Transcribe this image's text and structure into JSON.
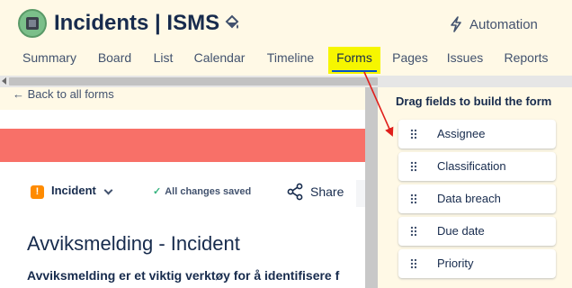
{
  "project": {
    "title": "Incidents | ISMS"
  },
  "header": {
    "automation_label": "Automation"
  },
  "tabs": [
    {
      "label": "Summary",
      "active": false
    },
    {
      "label": "Board",
      "active": false
    },
    {
      "label": "List",
      "active": false
    },
    {
      "label": "Calendar",
      "active": false
    },
    {
      "label": "Timeline",
      "active": false
    },
    {
      "label": "Forms",
      "active": true
    },
    {
      "label": "Pages",
      "active": false
    },
    {
      "label": "Issues",
      "active": false
    },
    {
      "label": "Reports",
      "active": false
    }
  ],
  "back_link": "← Back to all forms",
  "form": {
    "banner_color": "#f87068",
    "issue_type": "Incident",
    "save_status": "All changes saved",
    "share_label": "Share",
    "title": "Avviksmelding - Incident",
    "description": "Avviksmelding er et viktig verktøy for å identifisere f"
  },
  "panel": {
    "title": "Drag fields to build the form",
    "fields": [
      "Assignee",
      "Classification",
      "Data breach",
      "Due date",
      "Priority"
    ]
  },
  "colors": {
    "highlight": "#f6f600",
    "annotation_arrow": "#e0201c",
    "background": "#fff9e6"
  }
}
